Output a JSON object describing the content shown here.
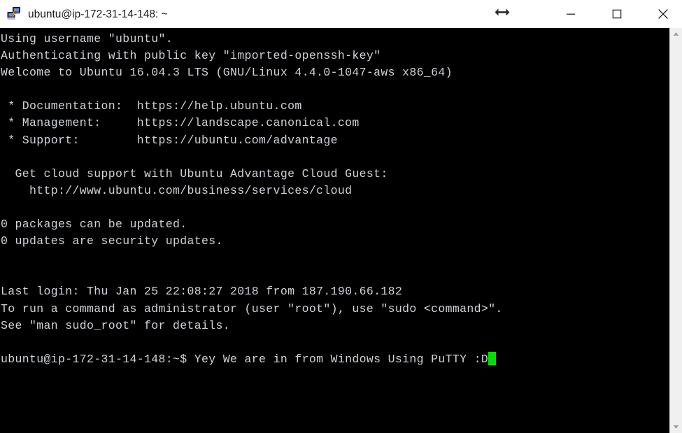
{
  "window": {
    "title": "ubuntu@ip-172-31-14-148: ~",
    "icon": "putty-icon",
    "background_color": "#000000",
    "titlebar_color": "#ffffff",
    "text_color": "#cfd4da",
    "cursor_color": "#00e000"
  },
  "titlebar": {
    "resize_hint_icon": "horizontal-resize-arrow-icon",
    "minimize_label": "—",
    "maximize_label": "□",
    "close_label": "✕"
  },
  "scrollbar": {
    "up_arrow": "▲",
    "down_arrow": "▼"
  },
  "terminal": {
    "lines": [
      "Using username \"ubuntu\".",
      "Authenticating with public key \"imported-openssh-key\"",
      "Welcome to Ubuntu 16.04.3 LTS (GNU/Linux 4.4.0-1047-aws x86_64)",
      "",
      " * Documentation:  https://help.ubuntu.com",
      " * Management:     https://landscape.canonical.com",
      " * Support:        https://ubuntu.com/advantage",
      "",
      "  Get cloud support with Ubuntu Advantage Cloud Guest:",
      "    http://www.ubuntu.com/business/services/cloud",
      "",
      "0 packages can be updated.",
      "0 updates are security updates.",
      "",
      "",
      "Last login: Thu Jan 25 22:08:27 2018 from 187.190.66.182",
      "To run a command as administrator (user \"root\"), use \"sudo <command>\".",
      "See \"man sudo_root\" for details.",
      ""
    ],
    "prompt": "ubuntu@ip-172-31-14-148:~$ ",
    "typed_command": "Yey We are in from Windows Using PuTTY :D"
  }
}
